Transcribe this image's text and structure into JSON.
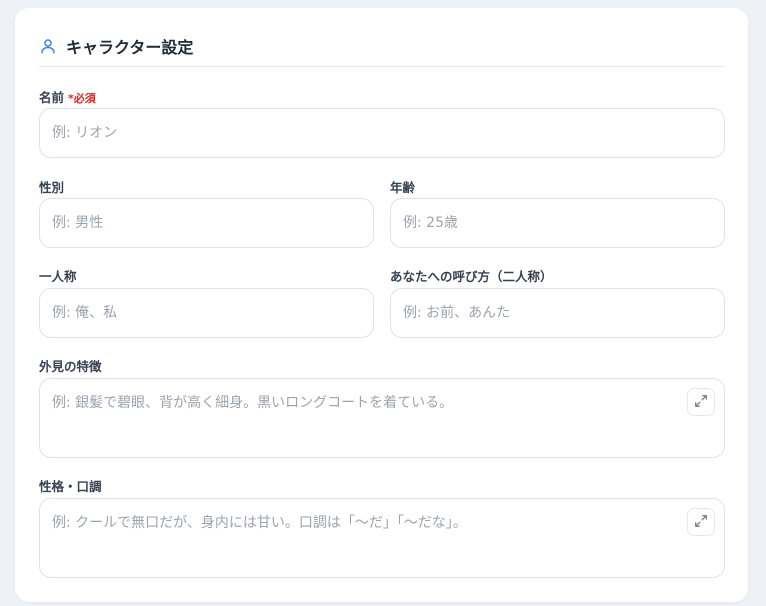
{
  "section": {
    "title": "キャラクター設定",
    "icon": "user-icon",
    "accent": "#3b82f6"
  },
  "fields": {
    "name": {
      "label": "名前",
      "required_mark": "*必須",
      "placeholder": "例: リオン"
    },
    "gender": {
      "label": "性別",
      "placeholder": "例: 男性"
    },
    "age": {
      "label": "年齢",
      "placeholder": "例: 25歳"
    },
    "first_person": {
      "label": "一人称",
      "placeholder": "例: 俺、私"
    },
    "second_person": {
      "label": "あなたへの呼び方（二人称）",
      "placeholder": "例: お前、あんた"
    },
    "appearance": {
      "label": "外見の特徴",
      "placeholder": "例: 銀髪で碧眼、背が高く細身。黒いロングコートを着ている。",
      "expand_icon": "expand-icon"
    },
    "personality": {
      "label": "性格・口調",
      "placeholder": "例: クールで無口だが、身内には甘い。口調は「〜だ」「〜だな」。",
      "expand_icon": "expand-icon"
    }
  }
}
